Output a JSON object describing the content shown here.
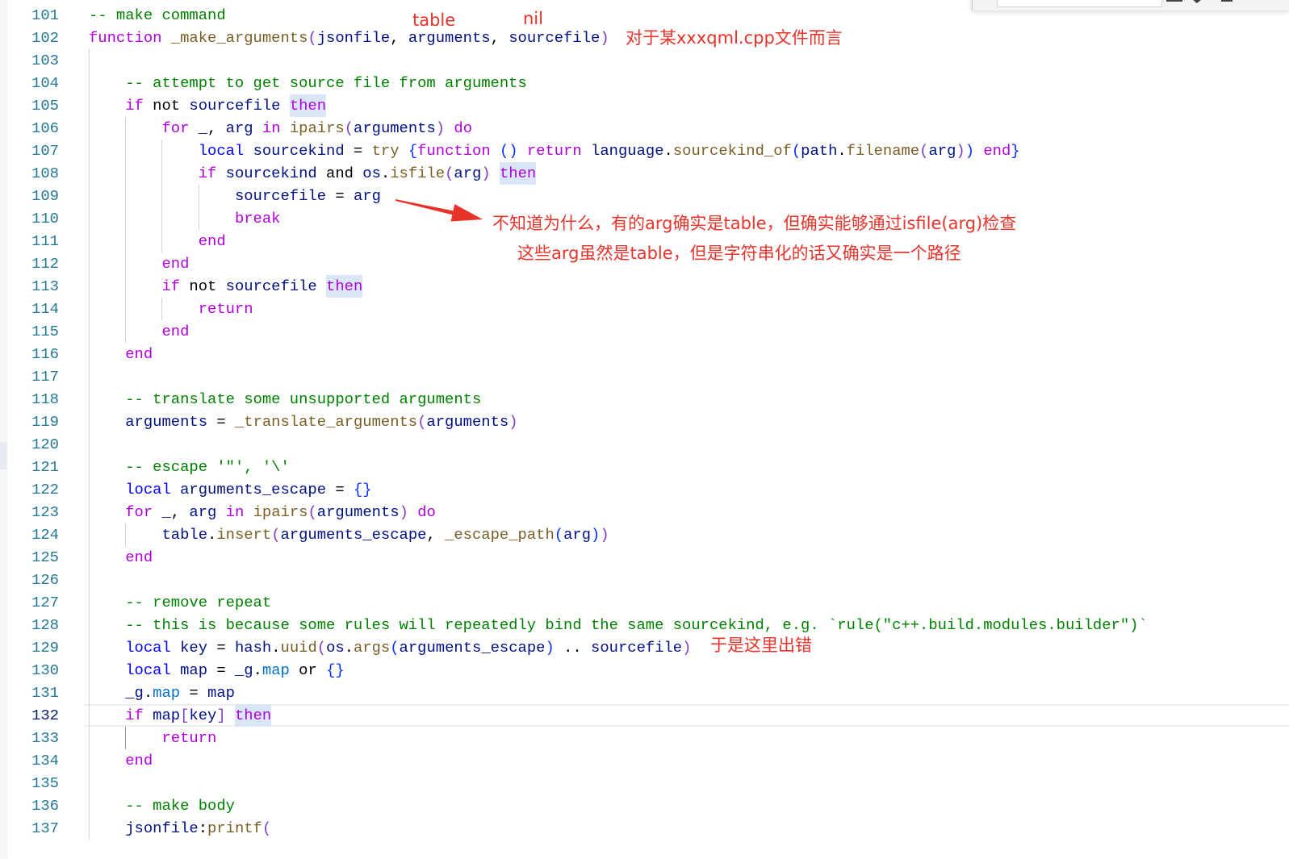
{
  "theme": {
    "background": "#ffffff",
    "line_number": "#237893",
    "line_number_active": "#0b216f",
    "comment": "#008000",
    "keyword": "#af00db",
    "storage": "#0000ff",
    "function": "#795e26",
    "variable": "#001080",
    "plain": "#000000",
    "member": "#0070c1",
    "bracket_1": "#7d3fc4",
    "bracket_2": "#0431fa",
    "brace": "#0431fa",
    "word_highlight": "#d9e6f6",
    "indent_guide": "#d3d3d3",
    "indent_guide_active": "#939393",
    "current_line_border": "#eeeeee",
    "annotation": "#e8332a"
  },
  "editor": {
    "lines": [
      {
        "num": "101",
        "tokens": [
          [
            "-- make command",
            "c"
          ]
        ]
      },
      {
        "num": "102",
        "tokens": [
          [
            "function",
            "k"
          ],
          [
            " ",
            "p"
          ],
          [
            "_make_arguments",
            "f"
          ],
          [
            "(",
            "b1"
          ],
          [
            "jsonfile",
            "v"
          ],
          [
            ", ",
            "p"
          ],
          [
            "arguments",
            "v"
          ],
          [
            ", ",
            "p"
          ],
          [
            "sourcefile",
            "v"
          ],
          [
            ")",
            "b1"
          ]
        ]
      },
      {
        "num": "103",
        "tokens": []
      },
      {
        "num": "104",
        "tokens": [
          [
            "    ",
            "w"
          ],
          [
            "-- attempt to get source file from arguments",
            "c"
          ]
        ]
      },
      {
        "num": "105",
        "tokens": [
          [
            "    ",
            "w"
          ],
          [
            "if",
            "k"
          ],
          [
            " not ",
            "p"
          ],
          [
            "sourcefile",
            "v"
          ],
          [
            " ",
            "p"
          ],
          [
            "then",
            "kh"
          ]
        ]
      },
      {
        "num": "106",
        "tokens": [
          [
            "        ",
            "w"
          ],
          [
            "for",
            "k"
          ],
          [
            " ",
            "p"
          ],
          [
            "_",
            "v"
          ],
          [
            ", ",
            "p"
          ],
          [
            "arg",
            "v"
          ],
          [
            " ",
            "p"
          ],
          [
            "in",
            "k"
          ],
          [
            " ",
            "p"
          ],
          [
            "ipairs",
            "f"
          ],
          [
            "(",
            "b1"
          ],
          [
            "arguments",
            "v"
          ],
          [
            ")",
            "b1"
          ],
          [
            " ",
            "p"
          ],
          [
            "do",
            "k"
          ]
        ]
      },
      {
        "num": "107",
        "tokens": [
          [
            "            ",
            "w"
          ],
          [
            "local",
            "s"
          ],
          [
            " ",
            "p"
          ],
          [
            "sourcekind",
            "v"
          ],
          [
            " = ",
            "p"
          ],
          [
            "try",
            "f"
          ],
          [
            " ",
            "p"
          ],
          [
            "{",
            "br"
          ],
          [
            "function",
            "k"
          ],
          [
            " ",
            "p"
          ],
          [
            "()",
            "b2"
          ],
          [
            " ",
            "p"
          ],
          [
            "return",
            "k"
          ],
          [
            " ",
            "p"
          ],
          [
            "language",
            "v"
          ],
          [
            ".",
            "p"
          ],
          [
            "sourcekind_of",
            "f"
          ],
          [
            "(",
            "b2"
          ],
          [
            "path",
            "v"
          ],
          [
            ".",
            "p"
          ],
          [
            "filename",
            "f"
          ],
          [
            "(",
            "b1"
          ],
          [
            "arg",
            "v"
          ],
          [
            ")",
            "b1"
          ],
          [
            ")",
            "b2"
          ],
          [
            " ",
            "p"
          ],
          [
            "end",
            "k"
          ],
          [
            "}",
            "br"
          ]
        ]
      },
      {
        "num": "108",
        "tokens": [
          [
            "            ",
            "w"
          ],
          [
            "if",
            "k"
          ],
          [
            " ",
            "p"
          ],
          [
            "sourcekind",
            "v"
          ],
          [
            " and ",
            "p"
          ],
          [
            "os",
            "v"
          ],
          [
            ".",
            "p"
          ],
          [
            "isfile",
            "f"
          ],
          [
            "(",
            "b1"
          ],
          [
            "arg",
            "v"
          ],
          [
            ")",
            "b1"
          ],
          [
            " ",
            "p"
          ],
          [
            "then",
            "kh"
          ]
        ]
      },
      {
        "num": "109",
        "tokens": [
          [
            "                ",
            "w"
          ],
          [
            "sourcefile",
            "v"
          ],
          [
            " = ",
            "p"
          ],
          [
            "arg",
            "v"
          ]
        ]
      },
      {
        "num": "110",
        "tokens": [
          [
            "                ",
            "w"
          ],
          [
            "break",
            "k"
          ]
        ]
      },
      {
        "num": "111",
        "tokens": [
          [
            "            ",
            "w"
          ],
          [
            "end",
            "k"
          ]
        ]
      },
      {
        "num": "112",
        "tokens": [
          [
            "        ",
            "w"
          ],
          [
            "end",
            "k"
          ]
        ]
      },
      {
        "num": "113",
        "tokens": [
          [
            "        ",
            "w"
          ],
          [
            "if",
            "k"
          ],
          [
            " not ",
            "p"
          ],
          [
            "sourcefile",
            "v"
          ],
          [
            " ",
            "p"
          ],
          [
            "then",
            "kh"
          ]
        ]
      },
      {
        "num": "114",
        "tokens": [
          [
            "            ",
            "w"
          ],
          [
            "return",
            "k"
          ]
        ]
      },
      {
        "num": "115",
        "tokens": [
          [
            "        ",
            "w"
          ],
          [
            "end",
            "k"
          ]
        ]
      },
      {
        "num": "116",
        "tokens": [
          [
            "    ",
            "w"
          ],
          [
            "end",
            "k"
          ]
        ]
      },
      {
        "num": "117",
        "tokens": []
      },
      {
        "num": "118",
        "tokens": [
          [
            "    ",
            "w"
          ],
          [
            "-- translate some unsupported arguments",
            "c"
          ]
        ]
      },
      {
        "num": "119",
        "tokens": [
          [
            "    ",
            "w"
          ],
          [
            "arguments",
            "v"
          ],
          [
            " = ",
            "p"
          ],
          [
            "_translate_arguments",
            "f"
          ],
          [
            "(",
            "b1"
          ],
          [
            "arguments",
            "v"
          ],
          [
            ")",
            "b1"
          ]
        ]
      },
      {
        "num": "120",
        "tokens": []
      },
      {
        "num": "121",
        "tokens": [
          [
            "    ",
            "w"
          ],
          [
            "-- escape '\"', '\\'",
            "c"
          ]
        ]
      },
      {
        "num": "122",
        "tokens": [
          [
            "    ",
            "w"
          ],
          [
            "local",
            "s"
          ],
          [
            " ",
            "p"
          ],
          [
            "arguments_escape",
            "v"
          ],
          [
            " = ",
            "p"
          ],
          [
            "{}",
            "br"
          ]
        ]
      },
      {
        "num": "123",
        "tokens": [
          [
            "    ",
            "w"
          ],
          [
            "for",
            "k"
          ],
          [
            " ",
            "p"
          ],
          [
            "_",
            "v"
          ],
          [
            ", ",
            "p"
          ],
          [
            "arg",
            "v"
          ],
          [
            " ",
            "p"
          ],
          [
            "in",
            "k"
          ],
          [
            " ",
            "p"
          ],
          [
            "ipairs",
            "f"
          ],
          [
            "(",
            "b1"
          ],
          [
            "arguments",
            "v"
          ],
          [
            ")",
            "b1"
          ],
          [
            " ",
            "p"
          ],
          [
            "do",
            "k"
          ]
        ]
      },
      {
        "num": "124",
        "tokens": [
          [
            "        ",
            "w"
          ],
          [
            "table",
            "v"
          ],
          [
            ".",
            "p"
          ],
          [
            "insert",
            "f"
          ],
          [
            "(",
            "b1"
          ],
          [
            "arguments_escape",
            "v"
          ],
          [
            ", ",
            "p"
          ],
          [
            "_escape_path",
            "f"
          ],
          [
            "(",
            "b2"
          ],
          [
            "arg",
            "v"
          ],
          [
            ")",
            "b2"
          ],
          [
            ")",
            "b1"
          ]
        ]
      },
      {
        "num": "125",
        "tokens": [
          [
            "    ",
            "w"
          ],
          [
            "end",
            "k"
          ]
        ]
      },
      {
        "num": "126",
        "tokens": []
      },
      {
        "num": "127",
        "tokens": [
          [
            "    ",
            "w"
          ],
          [
            "-- remove repeat",
            "c"
          ]
        ]
      },
      {
        "num": "128",
        "tokens": [
          [
            "    ",
            "w"
          ],
          [
            "-- this is because some rules will repeatedly bind the same sourcekind, e.g. `rule(\"c++.build.modules.builder\")`",
            "c"
          ]
        ]
      },
      {
        "num": "129",
        "tokens": [
          [
            "    ",
            "w"
          ],
          [
            "local",
            "s"
          ],
          [
            " ",
            "p"
          ],
          [
            "key",
            "v"
          ],
          [
            " = ",
            "p"
          ],
          [
            "hash",
            "v"
          ],
          [
            ".",
            "p"
          ],
          [
            "uuid",
            "f"
          ],
          [
            "(",
            "b1"
          ],
          [
            "os",
            "v"
          ],
          [
            ".",
            "p"
          ],
          [
            "args",
            "f"
          ],
          [
            "(",
            "b2"
          ],
          [
            "arguments_escape",
            "v"
          ],
          [
            ")",
            "b2"
          ],
          [
            " .. ",
            "p"
          ],
          [
            "sourcefile",
            "v"
          ],
          [
            ")",
            "b1"
          ]
        ]
      },
      {
        "num": "130",
        "tokens": [
          [
            "    ",
            "w"
          ],
          [
            "local",
            "s"
          ],
          [
            " ",
            "p"
          ],
          [
            "map",
            "v"
          ],
          [
            " = ",
            "p"
          ],
          [
            "_g",
            "v"
          ],
          [
            ".",
            "p"
          ],
          [
            "map",
            "m"
          ],
          [
            " or ",
            "p"
          ],
          [
            "{}",
            "br"
          ]
        ]
      },
      {
        "num": "131",
        "tokens": [
          [
            "    ",
            "w"
          ],
          [
            "_g",
            "v"
          ],
          [
            ".",
            "p"
          ],
          [
            "map",
            "m"
          ],
          [
            " = ",
            "p"
          ],
          [
            "map",
            "v"
          ]
        ]
      },
      {
        "num": "132",
        "active": true,
        "tokens": [
          [
            "    ",
            "w"
          ],
          [
            "if",
            "k"
          ],
          [
            " ",
            "p"
          ],
          [
            "map",
            "v"
          ],
          [
            "[",
            "b1"
          ],
          [
            "key",
            "v"
          ],
          [
            "]",
            "b1"
          ],
          [
            " ",
            "p"
          ],
          [
            "then",
            "kh"
          ]
        ]
      },
      {
        "num": "133",
        "tokens": [
          [
            "        ",
            "w"
          ],
          [
            "return",
            "k"
          ]
        ]
      },
      {
        "num": "134",
        "tokens": [
          [
            "    ",
            "w"
          ],
          [
            "end",
            "k"
          ]
        ]
      },
      {
        "num": "135",
        "tokens": []
      },
      {
        "num": "136",
        "tokens": [
          [
            "    ",
            "w"
          ],
          [
            "-- make body",
            "c"
          ]
        ]
      },
      {
        "num": "137",
        "tokens": [
          [
            "    ",
            "w"
          ],
          [
            "jsonfile",
            "v"
          ],
          [
            ":",
            "p"
          ],
          [
            "printf",
            "f"
          ],
          [
            "(",
            "b1"
          ]
        ]
      }
    ]
  },
  "annotations": {
    "table": "table",
    "nil": "nil",
    "file": "对于某xxxqml.cpp文件而言",
    "arg_note_1": "不知道为什么，有的arg确实是table，但确实能够通过isfile(arg)检查",
    "arg_note_2": "这些arg虽然是table，但是字符串化的话又确实是一个路径",
    "error_note": "于是这里出错"
  }
}
